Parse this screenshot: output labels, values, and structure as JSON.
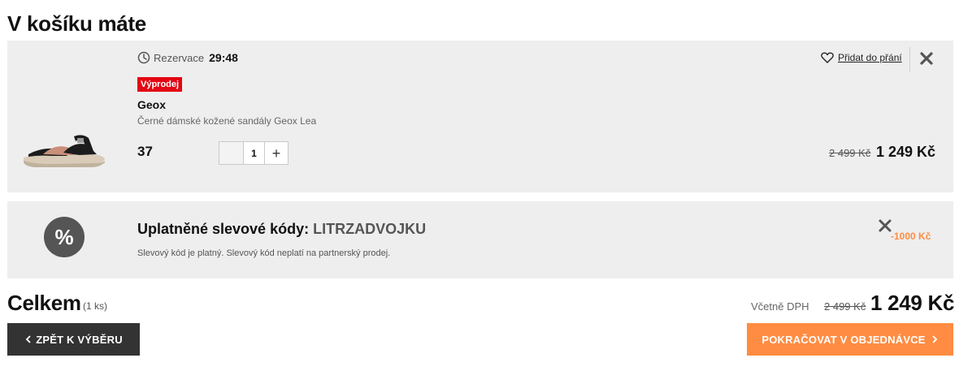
{
  "page": {
    "title": "V košíku máte"
  },
  "cart_item": {
    "reservation_label": "Rezervace",
    "reservation_time": "29:48",
    "badge": "Výprodej",
    "brand": "Geox",
    "description": "Černé dámské kožené sandály Geox Lea",
    "size": "37",
    "quantity": "1",
    "quantity_plus": "+",
    "wishlist_label": "Přidat do přání",
    "price_old": "2 499 Kč",
    "price_new": "1 249 Kč"
  },
  "discount": {
    "title": "Uplatněné slevové kódy:",
    "code": "LITRZADVOJKU",
    "note": "Slevový kód je platný. Slevový kód neplatí na partnerský prodej.",
    "amount": "-1000 Kč",
    "icon_symbol": "%"
  },
  "totals": {
    "label": "Celkem",
    "count": "(1 ks)",
    "vat_label": "Včetně DPH",
    "price_old": "2 499 Kč",
    "price_new": "1 249 Kč"
  },
  "buttons": {
    "back_label": "ZPĚT K VÝBĚRU",
    "continue_label": "POKRAČOVAT V OBJEDNÁVCE"
  },
  "colors": {
    "accent": "#ff8c42",
    "sale_red": "#e30613",
    "dark_button": "#333333",
    "card_bg": "#eeeeee"
  },
  "icons": [
    "clock-icon",
    "heart-icon",
    "close-icon",
    "percent-icon",
    "chevron-left-icon",
    "chevron-right-icon"
  ]
}
